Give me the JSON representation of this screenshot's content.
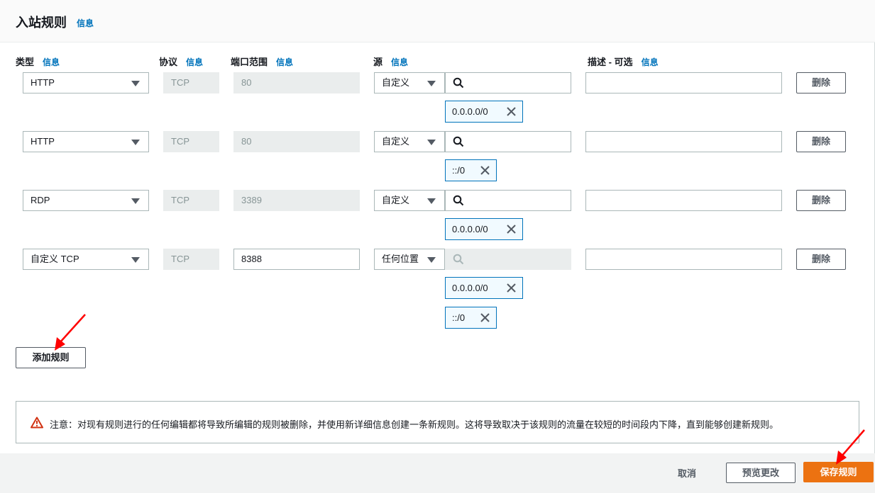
{
  "panel": {
    "title": "入站规则",
    "info": "信息"
  },
  "columns": {
    "type": "类型",
    "protocol": "协议",
    "port": "端口范围",
    "source": "源",
    "desc": "描述 - 可选",
    "info": "信息"
  },
  "rules": [
    {
      "type": "HTTP",
      "protocol": "TCP",
      "port": "80",
      "source": "自定义",
      "tokens": [
        "0.0.0.0/0"
      ],
      "delete": "删除"
    },
    {
      "type": "HTTP",
      "protocol": "TCP",
      "port": "80",
      "source": "自定义",
      "tokens": [
        "::/0"
      ],
      "delete": "删除"
    },
    {
      "type": "RDP",
      "protocol": "TCP",
      "port": "3389",
      "source": "自定义",
      "tokens": [
        "0.0.0.0/0"
      ],
      "delete": "删除"
    },
    {
      "type": "自定义 TCP",
      "protocol": "TCP",
      "port": "8388",
      "source": "任何位置",
      "tokens": [
        "0.0.0.0/0",
        "::/0"
      ],
      "delete": "删除"
    }
  ],
  "add_rule": "添加规则",
  "notice": "注意：对现有规则进行的任何编辑都将导致所编辑的规则被删除，并使用新详细信息创建一条新规则。这将导致取决于该规则的流量在较短的时间段内下降，直到能够创建新规则。",
  "footer": {
    "cancel": "取消",
    "preview": "预览更改",
    "save": "保存规则"
  },
  "colors": {
    "accent": "#ec7211",
    "link": "#0073bb",
    "token_border": "#0073bb",
    "annotation_arrow": "#ff0000"
  }
}
